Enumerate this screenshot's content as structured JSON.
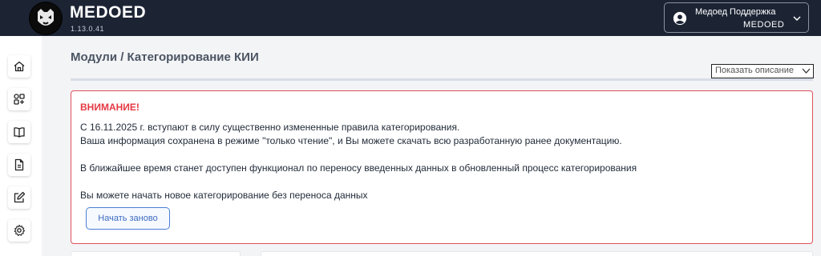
{
  "header": {
    "brand": "MEDOED",
    "version": "1.13.0.41",
    "user_name": "Медоед Поддержка",
    "user_org": "MEDOED"
  },
  "sidebar": {
    "items": [
      {
        "icon": "home-icon"
      },
      {
        "icon": "modules-icon"
      },
      {
        "icon": "book-icon"
      },
      {
        "icon": "document-icon"
      },
      {
        "icon": "edit-icon"
      },
      {
        "icon": "gear-icon"
      }
    ]
  },
  "main": {
    "title": "Модули / Категорирование КИИ",
    "show_description": "Показать описание"
  },
  "alert": {
    "title": "ВНИМАНИЕ!",
    "line1": "С 16.11.2025 г. вступают в силу существенно измененные правила категорирования.",
    "line2": "Ваша информация сохранена в режиме \"только чтение\", и Вы можете скачать всю разработанную ранее документацию.",
    "line3": "В ближайшее время станет доступен функционал по переносу введенных данных в обновленный процесс категорирования",
    "line4": "Вы можете начать новое категорирование без переноса данных",
    "button": "Начать заново"
  },
  "colors": {
    "topbar": "#1c2434",
    "alert_border": "#e0505c",
    "alert_title": "#e53943",
    "button_accent": "#4a7fd4"
  }
}
